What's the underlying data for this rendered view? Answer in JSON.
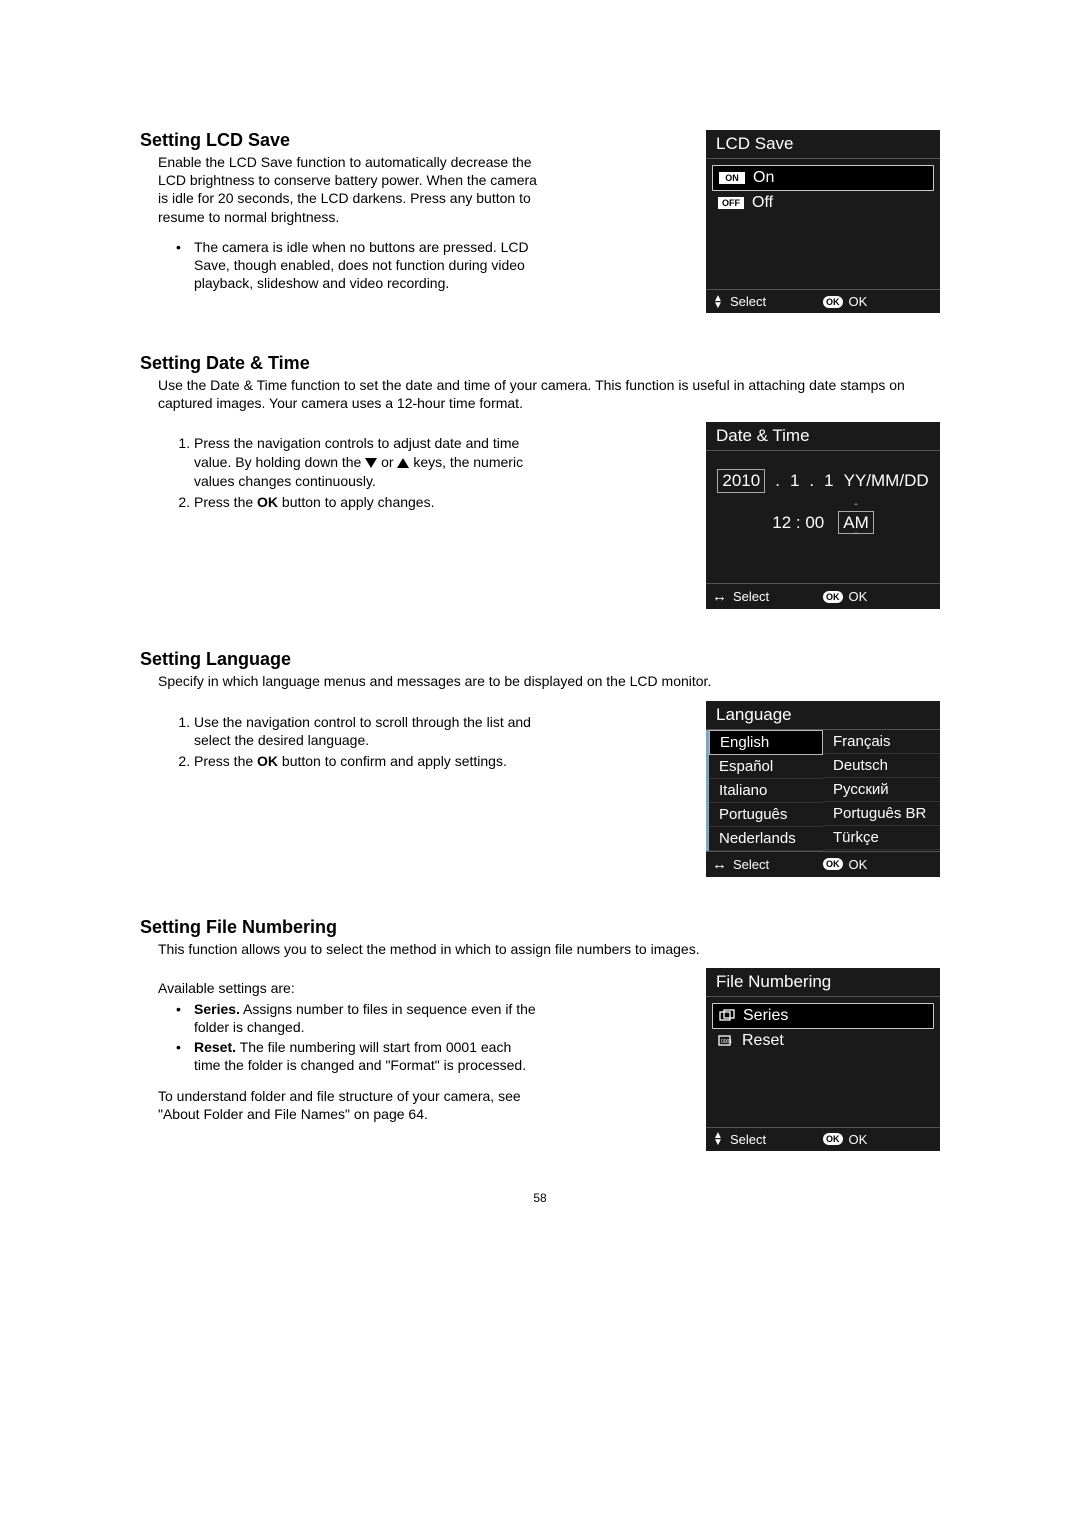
{
  "page_number": "58",
  "lcd_save": {
    "heading": "Setting LCD Save",
    "desc": "Enable the LCD Save function to automatically decrease the LCD brightness to conserve battery power. When the camera is idle for 20 seconds, the LCD darkens. Press any button to resume to normal brightness.",
    "bullet": "The camera is idle when no buttons are pressed. LCD Save, though enabled, does not function during video playback, slideshow and video recording.",
    "panel": {
      "title": "LCD Save",
      "on_badge": "ON",
      "on_label": "On",
      "off_badge": "OFF",
      "off_label": "Off",
      "select": "Select",
      "ok_chip": "OK",
      "ok_label": "OK"
    }
  },
  "date_time": {
    "heading": "Setting Date & Time",
    "desc": "Use the Date & Time function to set the date and time of your camera. This function is useful in attaching date stamps on captured images. Your camera uses a 12-hour time format.",
    "step1a": "Press the navigation controls to adjust date and time value. By holding down the ",
    "step1b": " or ",
    "step1c": " keys, the numeric values changes continuously.",
    "step2a": "Press the ",
    "step2_ok": "OK",
    "step2b": " button to apply changes.",
    "panel": {
      "title": "Date & Time",
      "year": "2010",
      "mm": "1",
      "dd": "1",
      "format": "YY/MM/DD",
      "time": "12 : 00",
      "ampm": "AM",
      "select": "Select",
      "ok_chip": "OK",
      "ok_label": "OK"
    }
  },
  "language": {
    "heading": "Setting Language",
    "desc": "Specify in which language menus and messages are to be displayed on the LCD monitor.",
    "step1": "Use the navigation control to scroll through the list and select the desired language.",
    "step2a": "Press the ",
    "step2_ok": "OK",
    "step2b": " button to confirm and apply settings.",
    "panel": {
      "title": "Language",
      "langs_left": [
        "English",
        "Español",
        "Italiano",
        "Português",
        "Nederlands"
      ],
      "langs_right": [
        "Français",
        "Deutsch",
        "Русский",
        "Português BR",
        "Türkçe"
      ],
      "select": "Select",
      "ok_chip": "OK",
      "ok_label": "OK"
    }
  },
  "file_numbering": {
    "heading": "Setting File Numbering",
    "desc": "This function allows you to select the method in which to assign file numbers to images.",
    "avail": "Available settings are:",
    "b1_bold": "Series.",
    "b1_text": " Assigns number to files in sequence even if the folder is changed.",
    "b2_bold": "Reset.",
    "b2_text": " The file numbering will start from 0001 each time the folder is changed and \"Format\" is processed.",
    "followup": "To understand folder and file structure of your camera, see \"About Folder and File Names\" on page 64.",
    "panel": {
      "title": "File Numbering",
      "series": "Series",
      "reset": "Reset",
      "select": "Select",
      "ok_chip": "OK",
      "ok_label": "OK"
    }
  }
}
